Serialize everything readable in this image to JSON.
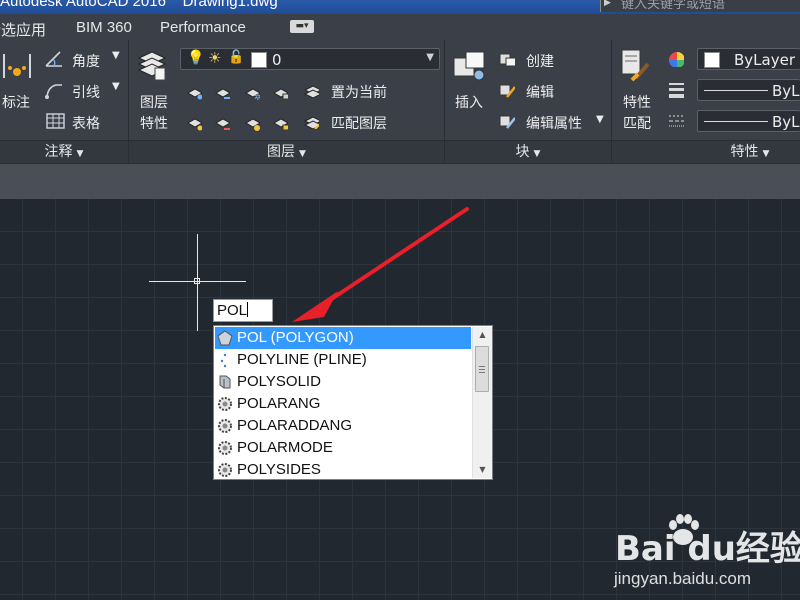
{
  "titlebar": {
    "title": "Autodesk AutoCAD 2016    Drawing1.dwg",
    "search_placeholder": "键入关键字或短语"
  },
  "tabs": [
    {
      "label": "精选应用"
    },
    {
      "label": "BIM 360"
    },
    {
      "label": "Performance"
    }
  ],
  "ribbon": {
    "annotate": {
      "dimension_label": "标注",
      "angle_label": "角度",
      "leader_label": "引线",
      "table_label": "表格",
      "footer": "注释"
    },
    "layers": {
      "properties_label_1": "图层",
      "properties_label_2": "特性",
      "current_layer": "0",
      "set_current_label": "置为当前",
      "match_layer_label": "匹配图层",
      "footer": "图层"
    },
    "block": {
      "insert_label": "插入",
      "create_label": "创建",
      "edit_label": "编辑",
      "edit_attributes_label": "编辑属性",
      "footer": "块"
    },
    "properties": {
      "match_label_1": "特性",
      "match_label_2": "匹配",
      "color_value": "ByLayer",
      "lineweight_value": "ByL",
      "linetype_value": "ByL",
      "footer": "特性"
    }
  },
  "drawing": {
    "command_input": "POL",
    "autocomplete": [
      {
        "label": "POL (POLYGON)",
        "icon": "polygon-icon",
        "selected": true
      },
      {
        "label": "POLYLINE (PLINE)",
        "icon": "polyline-icon",
        "selected": false
      },
      {
        "label": "POLYSOLID",
        "icon": "polysolid-icon",
        "selected": false
      },
      {
        "label": "POLARANG",
        "icon": "sysvar-gear-icon",
        "selected": false
      },
      {
        "label": "POLARADDANG",
        "icon": "sysvar-gear-icon",
        "selected": false
      },
      {
        "label": "POLARMODE",
        "icon": "sysvar-gear-icon",
        "selected": false
      },
      {
        "label": "POLYSIDES",
        "icon": "sysvar-gear-icon",
        "selected": false
      }
    ],
    "annotation_arrow_color": "#e8202a"
  },
  "watermark": {
    "logo_text": "Bai du经验",
    "url": "jingyan.baidu.com"
  }
}
